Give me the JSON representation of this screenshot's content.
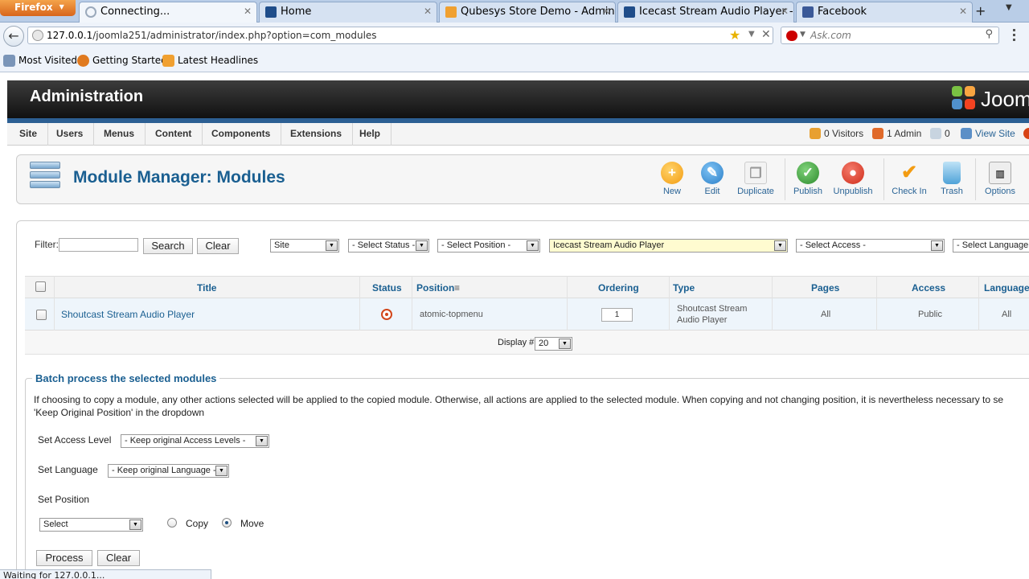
{
  "browser": {
    "app_button": "Firefox",
    "tabs": [
      {
        "title": "Connecting...",
        "color": "#9aa9bb"
      },
      {
        "title": "Home",
        "color": "#1f4d8a"
      },
      {
        "title": "Qubesys Store Demo - Administ...",
        "color": "#f0a030"
      },
      {
        "title": "Icecast Stream Audio Player - Jo...",
        "color": "#1f4d8a"
      },
      {
        "title": "Facebook",
        "color": "#3b5998"
      }
    ],
    "url_host": "127.0.0.1",
    "url_path": "/joomla251/administrator/index.php?option=com_modules",
    "search_placeholder": "Ask.com",
    "bookmarks": [
      "Most Visited",
      "Getting Started",
      "Latest Headlines"
    ],
    "status_text": "Waiting for 127.0.0.1..."
  },
  "header": {
    "title": "Administration",
    "logo_text": "Joomla"
  },
  "menu": {
    "items": [
      "Site",
      "Users",
      "Menus",
      "Content",
      "Components",
      "Extensions",
      "Help"
    ],
    "visitors": "0 Visitors",
    "admins": "1 Admin",
    "messages": "0",
    "view_site": "View Site"
  },
  "toolbar": {
    "page_title": "Module Manager: Modules",
    "buttons": [
      "New",
      "Edit",
      "Duplicate",
      "Publish",
      "Unpublish",
      "Check In",
      "Trash",
      "Options"
    ]
  },
  "filters": {
    "filter_label": "Filter:",
    "search_button": "Search",
    "clear_button": "Clear",
    "client": "Site",
    "status": "- Select Status -",
    "position": "- Select Position -",
    "module": "Icecast Stream Audio Player",
    "access": "- Select Access -",
    "language": "- Select Language -"
  },
  "table": {
    "headers": [
      "Title",
      "Status",
      "Position",
      "Ordering",
      "Type",
      "Pages",
      "Access",
      "Language"
    ],
    "rows": [
      {
        "title": "Shoutcast Stream Audio Player",
        "position": "atomic-topmenu",
        "ordering": "1",
        "type": "Shoutcast Stream Audio Player",
        "pages": "All",
        "access": "Public",
        "language": "All"
      }
    ],
    "display_label": "Display #",
    "display_value": "20"
  },
  "batch": {
    "legend": "Batch process the selected modules",
    "description_line1": "If choosing to copy a module, any other actions selected will be applied to the copied module. Otherwise, all actions are applied to the selected module. When copying and not changing position, it is nevertheless necessary to se",
    "description_line2": "'Keep Original Position' in the dropdown",
    "access_label": "Set Access Level",
    "access_value": "- Keep original Access Levels -",
    "language_label": "Set Language",
    "language_value": "- Keep original Language -",
    "position_label": "Set Position",
    "position_value": "Select",
    "copy_label": "Copy",
    "move_label": "Move",
    "selected_mode": "Move",
    "process_button": "Process",
    "clear_button": "Clear"
  }
}
